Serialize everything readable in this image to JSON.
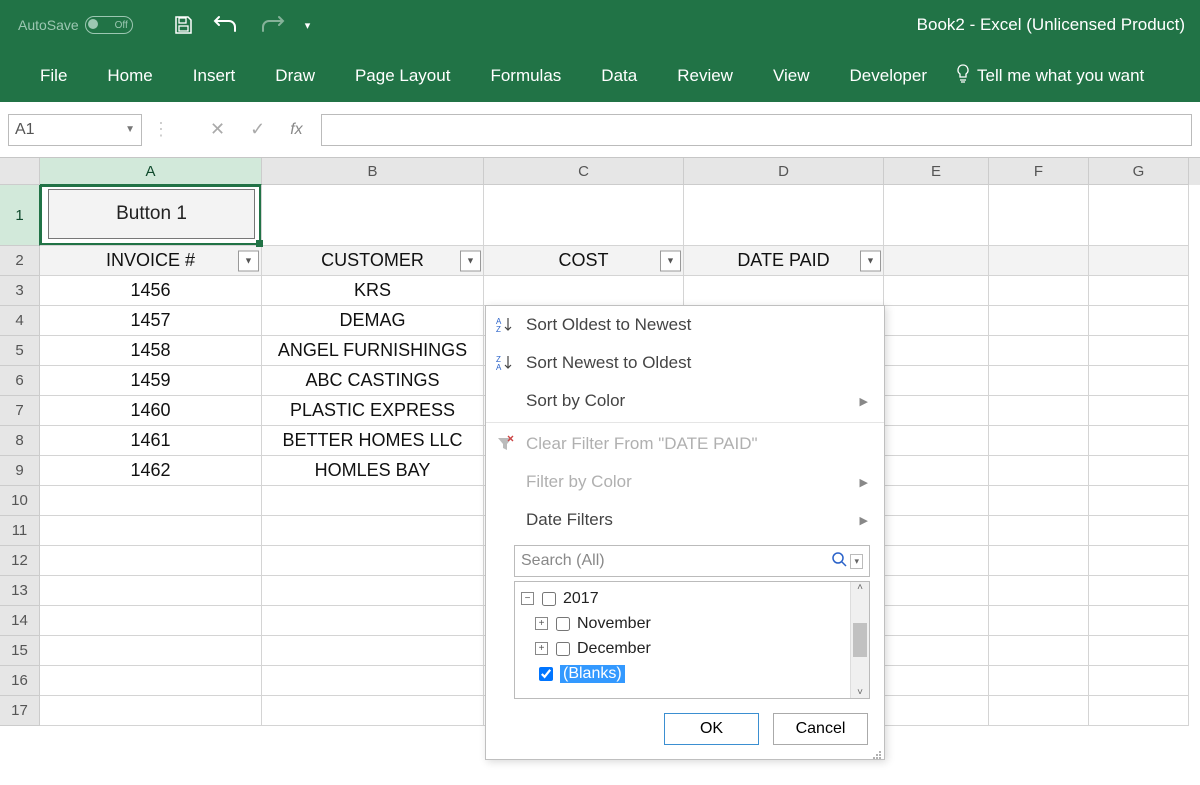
{
  "titlebar": {
    "autosave_label": "AutoSave",
    "autosave_state": "Off",
    "doc_title": "Book2  -  Excel (Unlicensed Product)"
  },
  "ribbon": {
    "tabs": [
      "File",
      "Home",
      "Insert",
      "Draw",
      "Page Layout",
      "Formulas",
      "Data",
      "Review",
      "View",
      "Developer"
    ],
    "tell_me": "Tell me what you want"
  },
  "formula_bar": {
    "name_box": "A1",
    "fx_label": "fx",
    "value": ""
  },
  "columns": [
    "A",
    "B",
    "C",
    "D",
    "E",
    "F",
    "G"
  ],
  "button1": "Button 1",
  "headers": {
    "invoice": "INVOICE #",
    "customer": "CUSTOMER",
    "cost": "COST",
    "date_paid": "DATE PAID"
  },
  "rows": [
    {
      "n": 3,
      "invoice": "1456",
      "customer": "KRS"
    },
    {
      "n": 4,
      "invoice": "1457",
      "customer": "DEMAG"
    },
    {
      "n": 5,
      "invoice": "1458",
      "customer": "ANGEL FURNISHINGS"
    },
    {
      "n": 6,
      "invoice": "1459",
      "customer": "ABC CASTINGS"
    },
    {
      "n": 7,
      "invoice": "1460",
      "customer": "PLASTIC EXPRESS"
    },
    {
      "n": 8,
      "invoice": "1461",
      "customer": "BETTER HOMES LLC"
    },
    {
      "n": 9,
      "invoice": "1462",
      "customer": "HOMLES BAY"
    }
  ],
  "empty_rows": [
    10,
    11,
    12,
    13,
    14,
    15,
    16,
    17
  ],
  "filter_popup": {
    "sort_oldest": "Sort Oldest to Newest",
    "sort_newest": "Sort Newest to Oldest",
    "sort_color": "Sort by Color",
    "clear_filter": "Clear Filter From \"DATE PAID\"",
    "filter_color": "Filter by Color",
    "date_filters": "Date Filters",
    "search_placeholder": "Search (All)",
    "tree": {
      "year": "2017",
      "months": [
        "November",
        "December"
      ],
      "blanks": "(Blanks)"
    },
    "ok": "OK",
    "cancel": "Cancel"
  }
}
